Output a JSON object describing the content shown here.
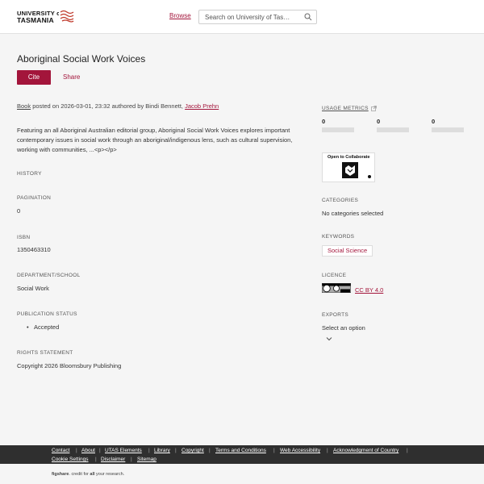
{
  "header": {
    "logo_line1": "UNIVERSITY of",
    "logo_line2": "TASMANIA",
    "browse_label": "Browse",
    "search_placeholder": "Search on University of Tas…"
  },
  "item": {
    "title": "Aboriginal Social Work Voices",
    "cite_label": "Cite",
    "share_label": "Share",
    "type": "Book",
    "posted_text": " posted on 2026-03-01, 23:32 authored by Bindi Bennett, ",
    "author_link": "Jacob Prehn",
    "description": "Featuring an all Aboriginal Australian editorial group, Aboriginal Social Work Voices explores important contemporary issues in social work through an aboriginal/indigenous lens, such as cultural supervision, working with communities, ...<p></p>"
  },
  "fields": {
    "history_label": "HISTORY",
    "pagination_label": "PAGINATION",
    "pagination_value": "0",
    "isbn_label": "ISBN",
    "isbn_value": "1350463310",
    "department_label": "DEPARTMENT/SCHOOL",
    "department_value": "Social Work",
    "pub_status_label": "PUBLICATION STATUS",
    "pub_status_value": "Accepted",
    "rights_label": "RIGHTS STATEMENT",
    "rights_value": "Copyright 2026 Bloomsbury Publishing"
  },
  "sidebar": {
    "usage_label": "USAGE METRICS",
    "metrics": [
      "0",
      "0",
      "0"
    ],
    "badge_text": "Open to Collaborate",
    "categories_label": "CATEGORIES",
    "categories_value": "No categories selected",
    "keywords_label": "KEYWORDS",
    "keyword": "Social Science",
    "licence_label": "LICENCE",
    "licence_link": "CC BY 4.0",
    "exports_label": "EXPORTS",
    "exports_value": "Select an option"
  },
  "footer": {
    "links": [
      "Contact",
      "About",
      "UTAS Elements",
      "Library",
      "Copyright",
      "Terms and Conditions",
      "Web Accessibility",
      "Acknowledgment of Country",
      "Cookie Settings",
      "Disclaimer",
      "Sitemap"
    ],
    "credit_brand": "figshare",
    "credit_text": ". credit for ",
    "credit_bold": "all",
    "credit_tail": " your research."
  },
  "colors": {
    "accent": "#a3153b",
    "footer_bg": "#2f2f2f",
    "page_bg": "#f5f5f5"
  }
}
